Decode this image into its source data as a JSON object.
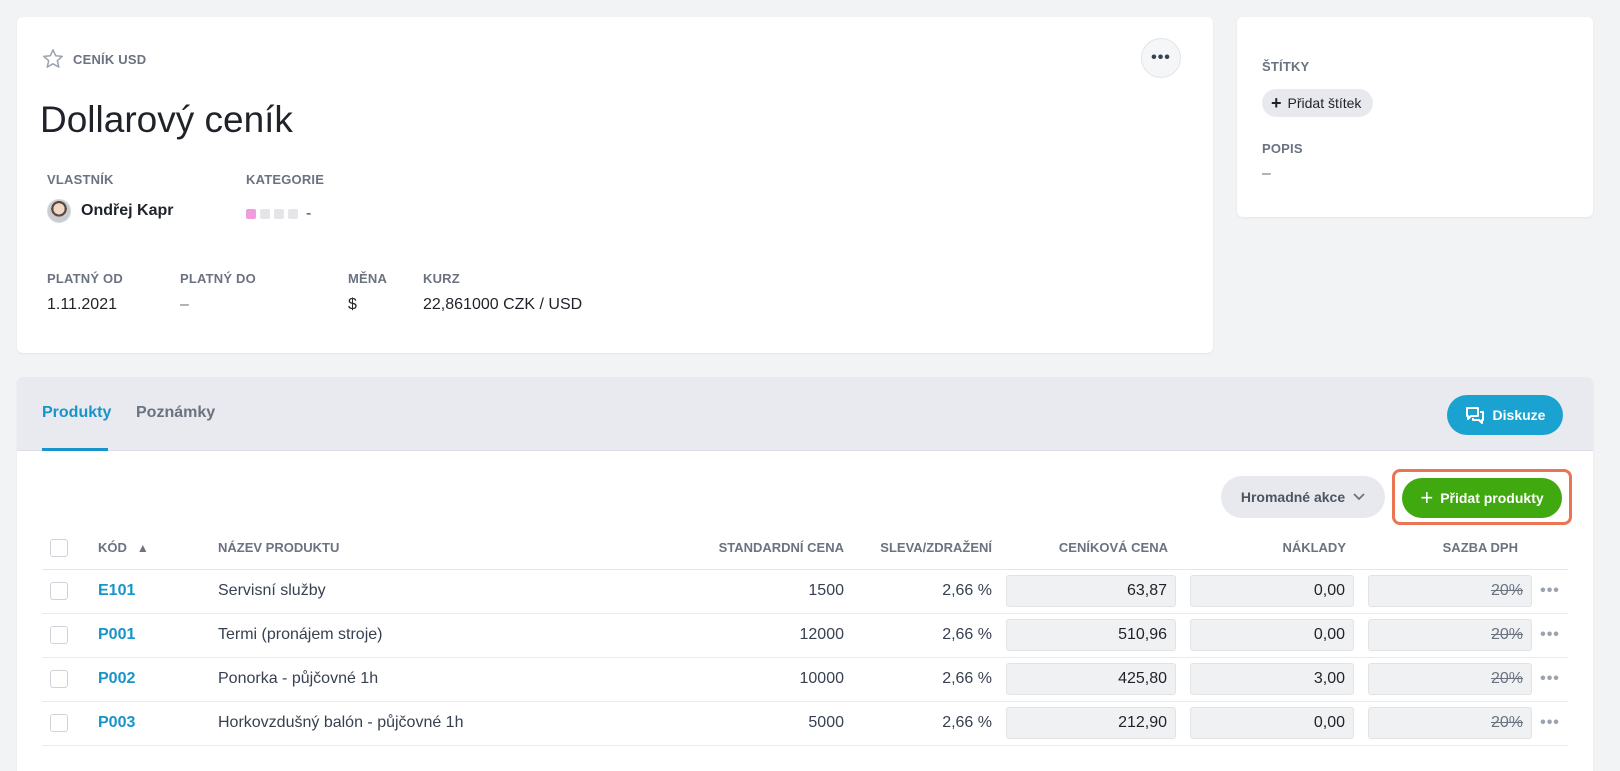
{
  "pricelist": {
    "type_label": "CENÍK USD",
    "title": "Dollarový ceník",
    "more_label": "•••",
    "owner": {
      "label": "VLASTNÍK",
      "name": "Ondřej Kapr"
    },
    "category": {
      "label": "KATEGORIE",
      "value": "-"
    },
    "valid_from": {
      "label": "PLATNÝ OD",
      "value": "1.11.2021"
    },
    "valid_to": {
      "label": "PLATNÝ DO",
      "value": "–"
    },
    "currency": {
      "label": "MĚNA",
      "value": "$"
    },
    "rate": {
      "label": "KURZ",
      "value": "22,861000 CZK / USD"
    }
  },
  "side": {
    "tags_label": "ŠTÍTKY",
    "add_tag_label": "Přidat štítek",
    "description_label": "POPIS",
    "description_value": "–"
  },
  "tabs": [
    {
      "label": "Produkty",
      "active": true
    },
    {
      "label": "Poznámky",
      "active": false
    }
  ],
  "toolbar": {
    "diskuze_label": "Diskuze",
    "bulk_label": "Hromadné akce",
    "add_products_label": "Přidat produkty"
  },
  "table": {
    "columns": {
      "code": "KÓD",
      "name": "NÁZEV PRODUKTU",
      "standard_price": "STANDARDNÍ CENA",
      "discount": "SLEVA/ZDRAŽENÍ",
      "list_price": "CENÍKOVÁ CENA",
      "cost": "NÁKLADY",
      "vat": "SAZBA DPH"
    },
    "rows": [
      {
        "code": "E101",
        "name": "Servisní služby",
        "standard_price": "1500",
        "discount": "2,66 %",
        "list_price": "63,87",
        "cost": "0,00",
        "vat": "20%"
      },
      {
        "code": "P001",
        "name": "Termi (pronájem stroje)",
        "standard_price": "12000",
        "discount": "2,66 %",
        "list_price": "510,96",
        "cost": "0,00",
        "vat": "20%"
      },
      {
        "code": "P002",
        "name": "Ponorka - půjčovné 1h",
        "standard_price": "10000",
        "discount": "2,66 %",
        "list_price": "425,80",
        "cost": "3,00",
        "vat": "20%"
      },
      {
        "code": "P003",
        "name": "Horkovzdušný balón - půjčovné 1h",
        "standard_price": "5000",
        "discount": "2,66 %",
        "list_price": "212,90",
        "cost": "0,00",
        "vat": "20%"
      }
    ],
    "row_more_label": "•••"
  },
  "colors": {
    "accent": "#1794c9",
    "add_button": "#3fa90f",
    "diskuze_button": "#1aa3d0",
    "highlight_border": "#e97552"
  }
}
